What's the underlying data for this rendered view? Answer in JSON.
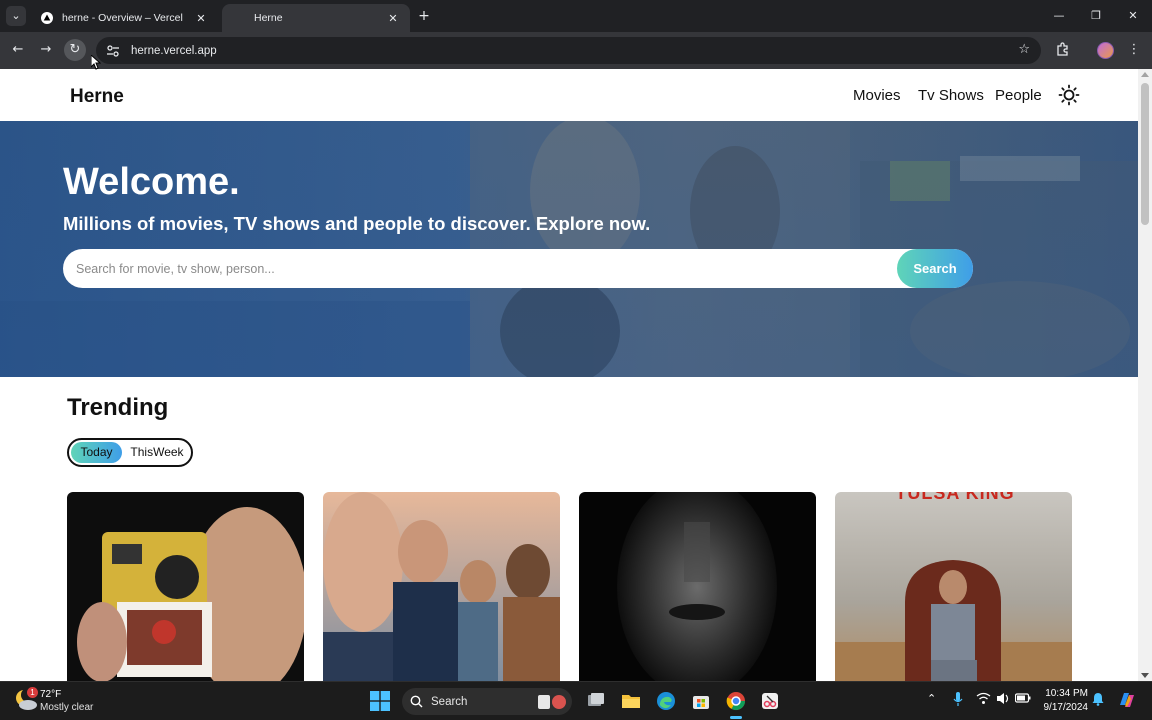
{
  "browser": {
    "tabs": [
      {
        "title": "herne - Overview – Vercel",
        "active": false
      },
      {
        "title": "Herne",
        "active": true
      }
    ],
    "url": "herne.vercel.app"
  },
  "site": {
    "brand": "Herne",
    "nav": [
      {
        "label": "Movies"
      },
      {
        "label": "Tv Shows"
      },
      {
        "label": "People"
      }
    ],
    "hero": {
      "title": "Welcome.",
      "subtitle": "Millions of movies, TV shows and people to discover. Explore now.",
      "search_placeholder": "Search for movie, tv show, person...",
      "search_button": "Search"
    },
    "trending": {
      "title": "Trending",
      "toggle": [
        {
          "label": "Today",
          "selected": true
        },
        {
          "label": "ThisWeek",
          "selected": false
        }
      ],
      "cards": [
        {
          "name": "poster-1",
          "partial_title": ""
        },
        {
          "name": "poster-2",
          "partial_title": ""
        },
        {
          "name": "poster-3",
          "partial_title": ""
        },
        {
          "name": "poster-4",
          "partial_title": "TULSA KING"
        }
      ]
    }
  },
  "taskbar": {
    "weather_temp": "72°F",
    "weather_desc": "Mostly clear",
    "weather_badge": "1",
    "search_label": "Search",
    "time": "10:34 PM",
    "date": "9/17/2024"
  },
  "colors": {
    "accent_gradient_start": "#5fd4b8",
    "accent_gradient_end": "#3f9ee8",
    "hero_blue": "#2f5a8f"
  }
}
